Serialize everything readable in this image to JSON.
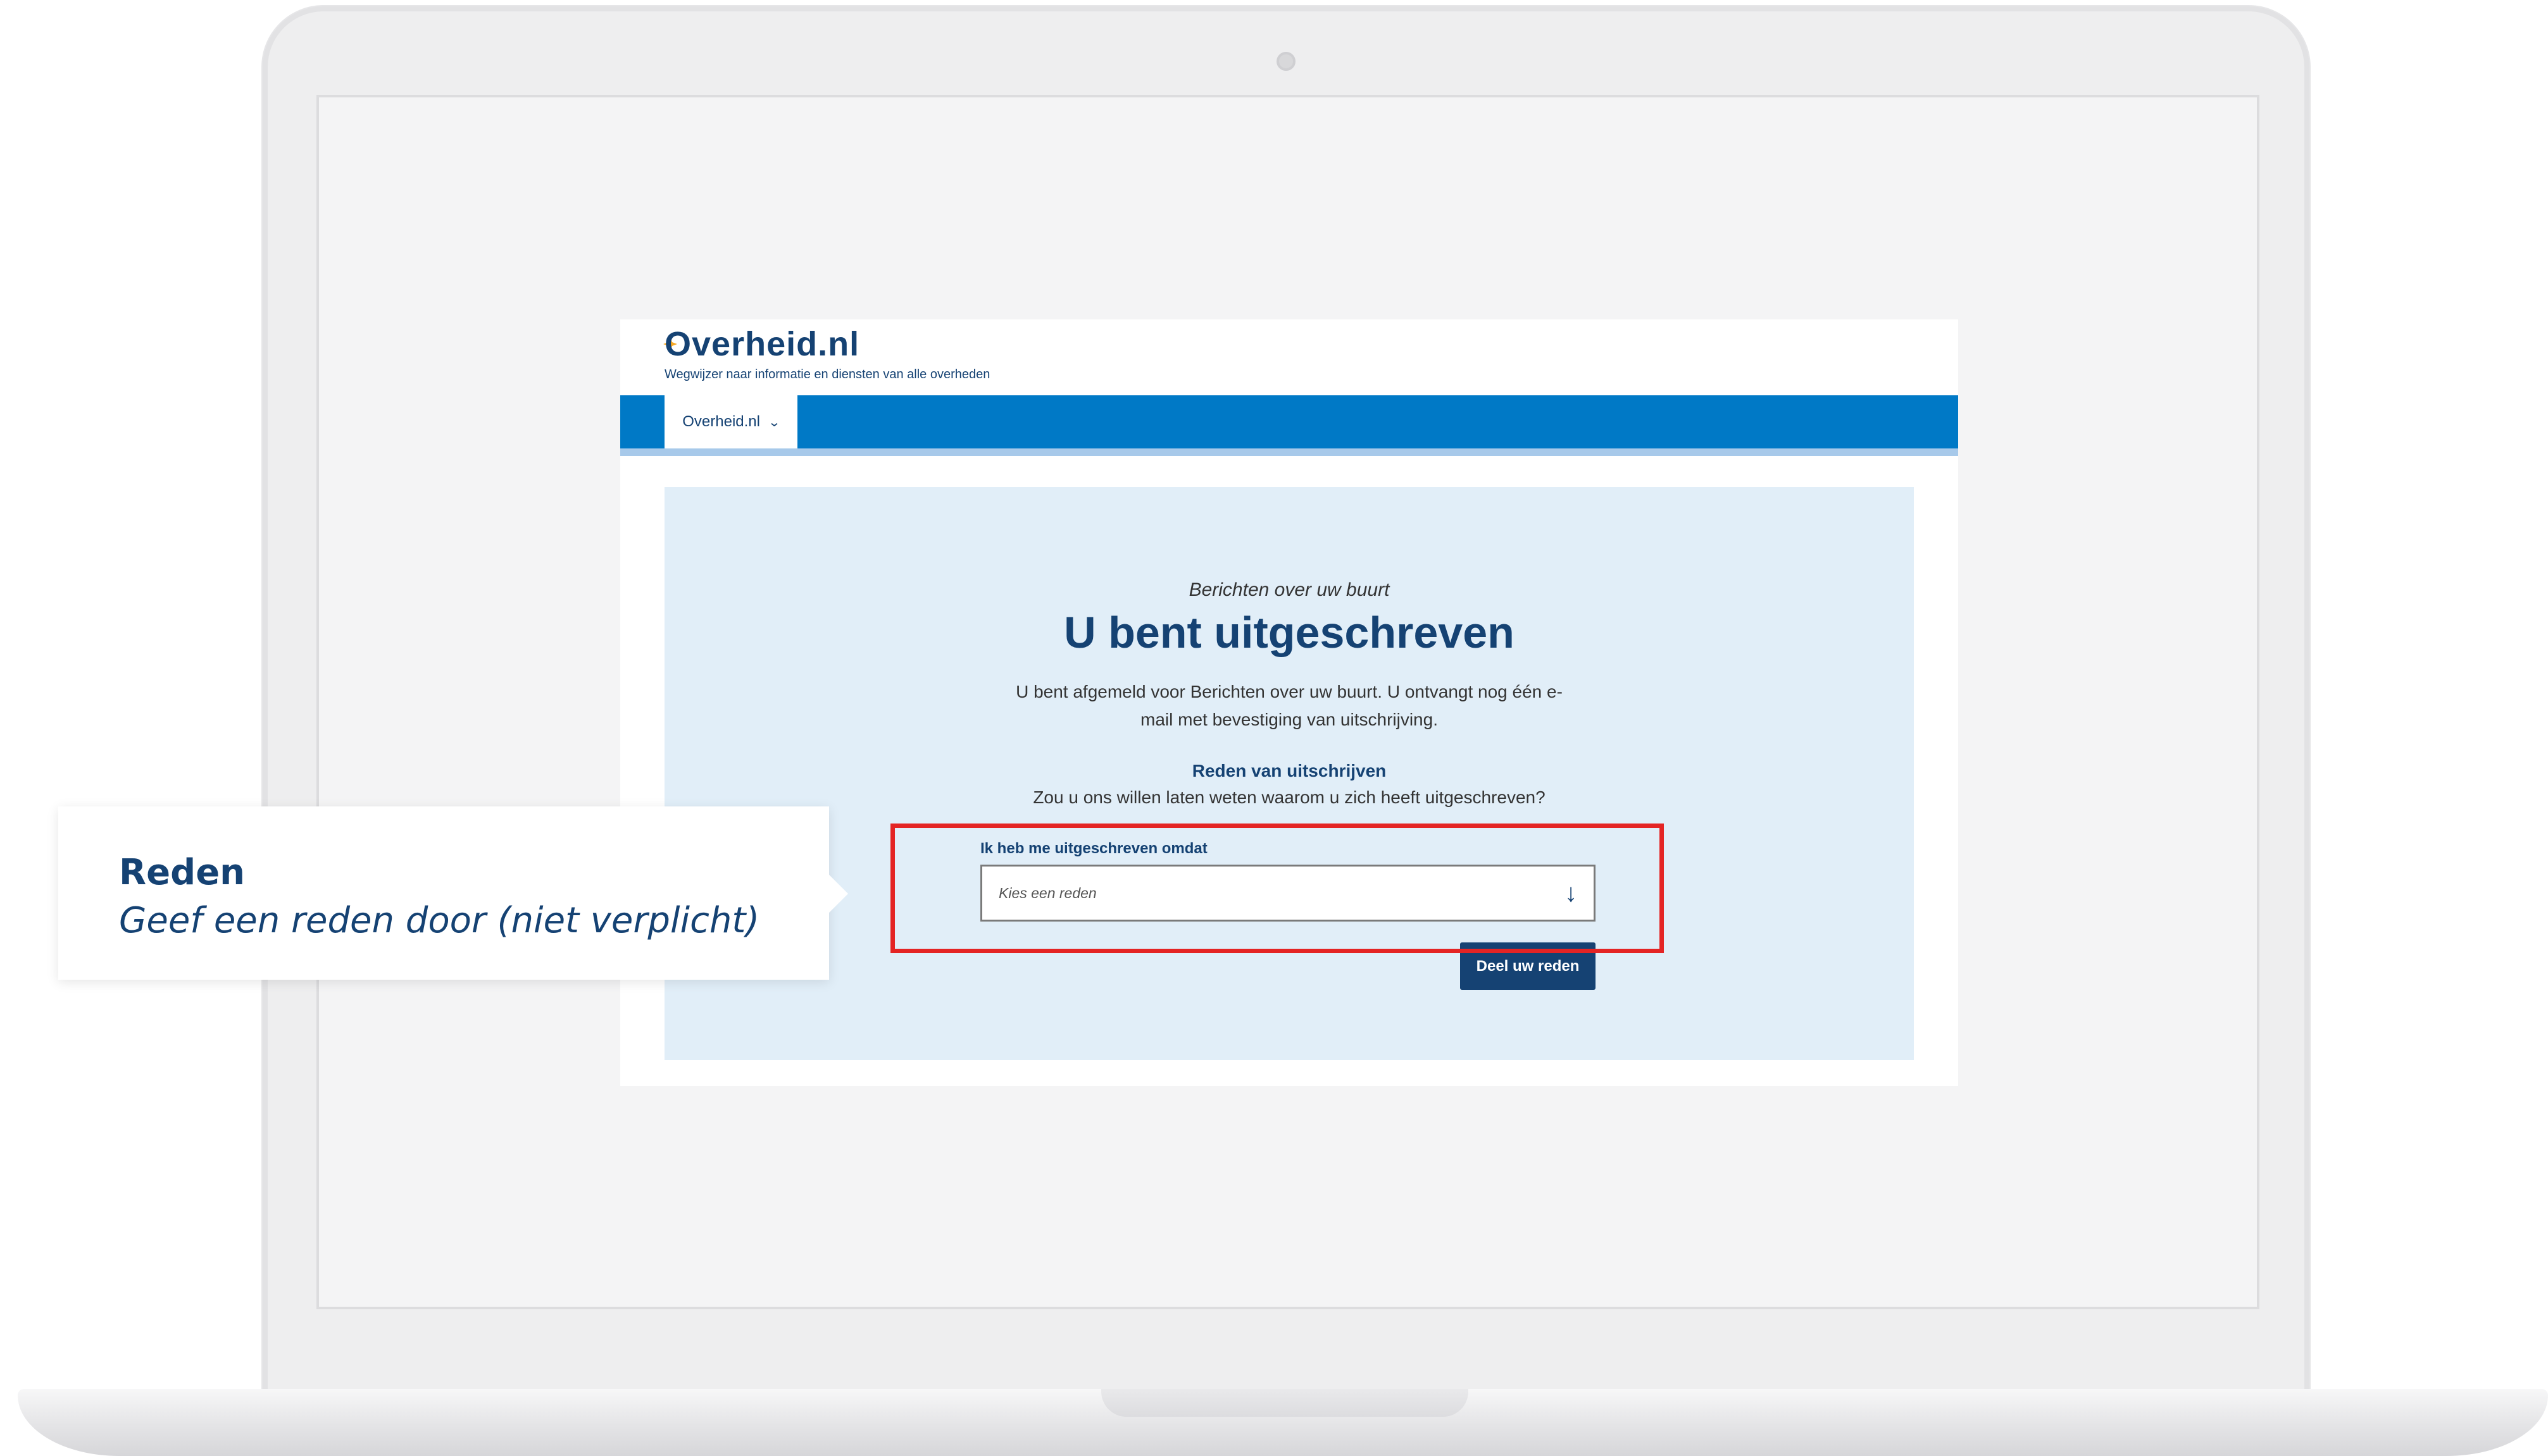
{
  "site": {
    "logo_text": "Overheid.nl",
    "tagline": "Wegwijzer naar informatie en diensten van alle overheden",
    "nav_tab_label": "Overheid.nl",
    "brand_color": "#154273",
    "nav_color": "#0079c6"
  },
  "main": {
    "overline": "Berichten over uw buurt",
    "title": "U bent uitgeschreven",
    "intro_line1": "U bent afgemeld voor Berichten over uw buurt. U ontvangt nog één e-",
    "intro_line2": "mail met bevestiging van uitschrijving.",
    "reason_title": "Reden van uitschrijven",
    "reason_question": "Zou u ons willen laten weten waarom u zich heeft uitgeschreven?"
  },
  "form": {
    "field_label": "Ik heb me uitgeschreven omdat",
    "select_placeholder": "Kies een reden",
    "submit_label": "Deel uw reden"
  },
  "callout": {
    "title": "Reden",
    "subtitle": "Geef een reden door (niet verplicht)"
  },
  "highlight_color": "#e42424"
}
